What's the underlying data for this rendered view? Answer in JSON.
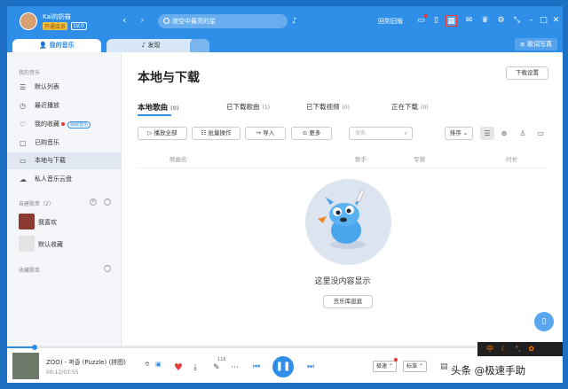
{
  "app": {
    "accent": "#2f8fe8",
    "title_bar_color": "#2f8fe8"
  },
  "user": {
    "name": "Kai的奶猫",
    "vip_label": "开通会员",
    "level": "LV.0"
  },
  "header": {
    "search_placeholder": "夜空中最亮的星",
    "back_old_label": "回到旧版",
    "icons": [
      "mini-player-icon",
      "phone-icon",
      "apps-icon",
      "mail-icon",
      "skin-icon",
      "settings-icon",
      "shrink-icon",
      "minimize-icon",
      "maximize-icon",
      "close-icon"
    ]
  },
  "tabs": [
    {
      "label": "我的音乐"
    },
    {
      "label": "发现"
    }
  ],
  "lyrics_label": "歌词写真",
  "sidebar": {
    "section_my": "我的音乐",
    "items": [
      {
        "label": "默认列表",
        "icon": "list-icon"
      },
      {
        "label": "最近播放",
        "icon": "clock-icon"
      },
      {
        "label": "我的收藏",
        "icon": "heart-icon",
        "badge": "领取音乐"
      },
      {
        "label": "已购音乐",
        "icon": "bag-icon"
      },
      {
        "label": "本地与下载",
        "icon": "monitor-icon"
      },
      {
        "label": "私人音乐云盘",
        "icon": "cloud-icon"
      }
    ],
    "created_label": "自建歌单（2）",
    "playlists": [
      {
        "label": "我喜欢"
      },
      {
        "label": "默认收藏"
      }
    ],
    "collected_label": "收藏歌单"
  },
  "main": {
    "title": "本地与下载",
    "download_settings": "下载设置",
    "subtabs": [
      {
        "label": "本地歌曲",
        "count": "(0)"
      },
      {
        "label": "已下载歌曲",
        "count": "(1)"
      },
      {
        "label": "已下载视频",
        "count": "(0)"
      },
      {
        "label": "正在下载",
        "count": "(0)"
      }
    ],
    "toolbar": {
      "play_all": "播放全部",
      "batch": "批量操作",
      "import": "导入",
      "more": "更多",
      "search_placeholder": "搜索",
      "sort": "排序"
    },
    "columns": [
      "歌曲名",
      "歌手",
      "专辑",
      "时长"
    ],
    "empty_text": "这里没内容显示",
    "goto_button": "去乐库逛逛"
  },
  "player": {
    "song": "ZOO) - 퍼즐 (Puzzle) (拼图)",
    "time": "00:12/03:55",
    "comment_count": "116",
    "playback_progress": 0.05,
    "quality_label": "极速",
    "speed_label": "标准",
    "ime_label": "中"
  },
  "watermark": "头条 @极速手助"
}
